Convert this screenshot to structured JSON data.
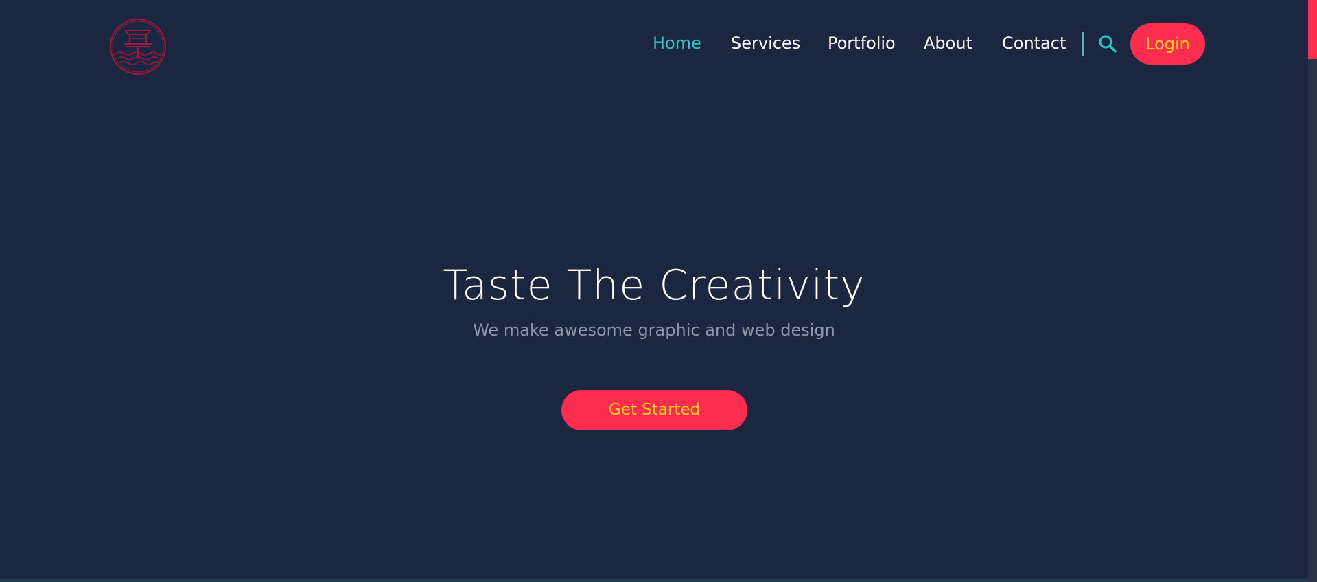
{
  "header": {
    "logo_icon": "temple-waves-logo-icon",
    "nav": [
      {
        "label": "Home",
        "active": true
      },
      {
        "label": "Services",
        "active": false
      },
      {
        "label": "Portfolio",
        "active": false
      },
      {
        "label": "About",
        "active": false
      },
      {
        "label": "Contact",
        "active": false
      }
    ],
    "search_icon": "search-icon",
    "login_label": "Login"
  },
  "hero": {
    "title": "Taste The Creativity",
    "subtitle": "We make awesome graphic and web design",
    "cta_label": "Get Started"
  },
  "colors": {
    "background": "#1b2741",
    "accent": "#fd2d4f",
    "active_link": "#2bc3c4",
    "button_text": "#ffd21a"
  }
}
